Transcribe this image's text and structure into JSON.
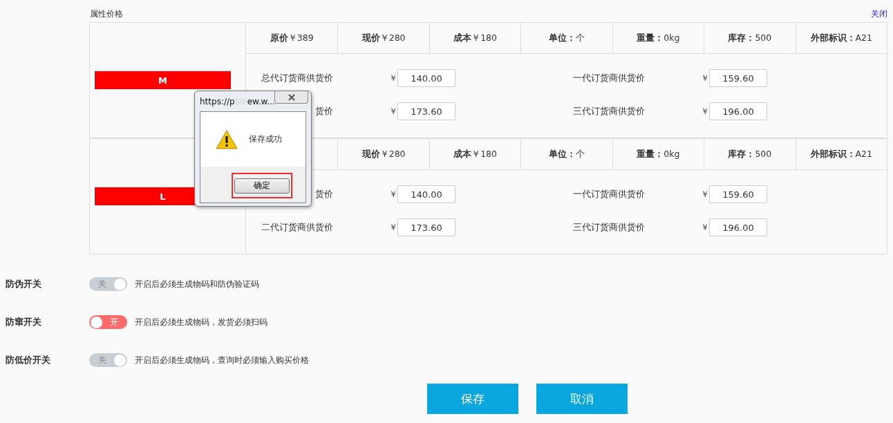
{
  "section": {
    "title": "属性价格",
    "close_link": "关闭"
  },
  "variants": [
    {
      "tag": "M",
      "headers": [
        {
          "label": "原价",
          "value": "￥389"
        },
        {
          "label": "现价",
          "value": "￥280"
        },
        {
          "label": "成本",
          "value": "￥180"
        },
        {
          "label": "单位：",
          "value": "个"
        },
        {
          "label": "重量：",
          "value": "0kg"
        },
        {
          "label": "库存：",
          "value": "500"
        },
        {
          "label": "外部标识：",
          "value": "A21"
        }
      ],
      "prices": [
        {
          "label": "总代订货商供货价",
          "currency": "￥",
          "value": "140.00"
        },
        {
          "label": "一代订货商供货价",
          "currency": "￥",
          "value": "159.60"
        },
        {
          "label": "货价",
          "currency": "￥",
          "value": "173.60"
        },
        {
          "label": "三代订货商供货价",
          "currency": "￥",
          "value": "196.00"
        }
      ]
    },
    {
      "tag": "L",
      "headers": [
        {
          "label": "现价",
          "value": "￥280"
        },
        {
          "label": "成本",
          "value": "￥180"
        },
        {
          "label": "单位：",
          "value": "个"
        },
        {
          "label": "重量：",
          "value": "0kg"
        },
        {
          "label": "库存：",
          "value": "500"
        },
        {
          "label": "外部标识：",
          "value": "A21"
        }
      ],
      "prices": [
        {
          "label": "货价",
          "currency": "￥",
          "value": "140.00"
        },
        {
          "label": "一代订货商供货价",
          "currency": "￥",
          "value": "159.60"
        },
        {
          "label": "二代订货商供货价",
          "currency": "￥",
          "value": "173.60"
        },
        {
          "label": "三代订货商供货价",
          "currency": "￥",
          "value": "196.00"
        }
      ]
    }
  ],
  "switches": [
    {
      "label": "防伪开关",
      "on": false,
      "state_text": "关",
      "description": "开启后必须生成物码和防伪验证码"
    },
    {
      "label": "防窜开关",
      "on": true,
      "state_text": "开",
      "description": "开启后必须生成物码，发货必须扫码"
    },
    {
      "label": "防低价开关",
      "on": false,
      "state_text": "关",
      "description": "开启后必须生成物码，查询时必须输入购买价格"
    }
  ],
  "buttons": [
    {
      "label": "保存"
    },
    {
      "label": "取消"
    }
  ],
  "dialog": {
    "title_start": "https://p",
    "title_end": "ew.w...",
    "message": "保存成功",
    "ok_button": "确定"
  }
}
